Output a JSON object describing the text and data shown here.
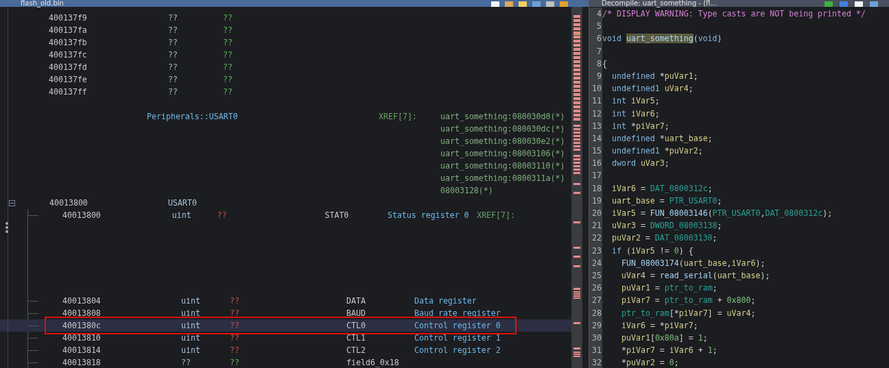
{
  "listing": {
    "title": "flash_old.bin",
    "byte_rows": [
      {
        "address": "400137f9",
        "bytes": "??",
        "value": "??"
      },
      {
        "address": "400137fa",
        "bytes": "??",
        "value": "??"
      },
      {
        "address": "400137fb",
        "bytes": "??",
        "value": "??"
      },
      {
        "address": "400137fc",
        "bytes": "??",
        "value": "??"
      },
      {
        "address": "400137fd",
        "bytes": "??",
        "value": "??"
      },
      {
        "address": "400137fe",
        "bytes": "??",
        "value": "??"
      },
      {
        "address": "400137ff",
        "bytes": "??",
        "value": "??"
      }
    ],
    "label": {
      "name": "Peripherals::USART0",
      "xref_label": "XREF[7]:",
      "xrefs": [
        "uart_something:080030d0(*)",
        "uart_something:080030dc(*)",
        "uart_something:080030e2(*)",
        "uart_something:08003106(*)",
        "uart_something:08003110(*)",
        "uart_something:0800311a(*)",
        "08003128(*)"
      ]
    },
    "struct": {
      "address": "40013800",
      "name": "USART0",
      "expanded": true,
      "fields": [
        {
          "kind": "defined",
          "address": "40013800",
          "type": "uint",
          "value": "??",
          "name": "STAT0",
          "comment": "Status register 0",
          "xref": "XREF[7]:",
          "selected": false,
          "outlined": false
        },
        {
          "kind": "defined",
          "address": "40013804",
          "type": "uint",
          "value": "??",
          "name": "DATA",
          "comment": "Data register",
          "selected": false,
          "outlined": false
        },
        {
          "kind": "defined",
          "address": "40013808",
          "type": "uint",
          "value": "??",
          "name": "BAUD",
          "comment": "Baud rate register",
          "selected": false,
          "outlined": false
        },
        {
          "kind": "defined",
          "address": "4001380c",
          "type": "uint",
          "value": "??",
          "name": "CTL0",
          "comment": "Control register 0",
          "selected": true,
          "outlined": true
        },
        {
          "kind": "defined",
          "address": "40013810",
          "type": "uint",
          "value": "??",
          "name": "CTL1",
          "comment": "Control register 1",
          "selected": false,
          "outlined": false
        },
        {
          "kind": "defined",
          "address": "40013814",
          "type": "uint",
          "value": "??",
          "name": "CTL2",
          "comment": "Control register 2",
          "selected": false,
          "outlined": false
        },
        {
          "kind": "undefined",
          "address": "40013818",
          "type": "??",
          "value": "??",
          "name": "field6_0x18",
          "selected": false,
          "outlined": false
        }
      ]
    }
  },
  "decompiler": {
    "title": "Decompile: uart_something - (fl...",
    "lines": [
      {
        "number": "4",
        "tokens": [
          {
            "text": "/* DISPLAY WARNING: Type casts are NOT being printed */",
            "kind": "comment"
          }
        ]
      },
      {
        "number": "5"
      },
      {
        "number": "6",
        "tokens": [
          {
            "text": "void ",
            "kind": "type"
          },
          {
            "text": "uart_something",
            "kind": "func",
            "highlighted": true
          },
          {
            "text": "(",
            "kind": "plain"
          },
          {
            "text": "void",
            "kind": "type"
          },
          {
            "text": ")",
            "kind": "plain"
          }
        ]
      },
      {
        "number": "7"
      },
      {
        "number": "8",
        "tokens": [
          {
            "text": "{",
            "kind": "plain"
          }
        ],
        "children": [
          {
            "number": "9",
            "tokens": [
              {
                "text": "undefined",
                "kind": "type"
              },
              {
                "text": " *",
                "kind": "plain"
              },
              {
                "text": "puVar1",
                "kind": "var"
              },
              {
                "text": ";",
                "kind": "plain"
              }
            ]
          },
          {
            "number": "10",
            "tokens": [
              {
                "text": "undefined1 ",
                "kind": "type"
              },
              {
                "text": "uVar4",
                "kind": "var"
              },
              {
                "text": ";",
                "kind": "plain"
              }
            ]
          },
          {
            "number": "11",
            "tokens": [
              {
                "text": "int ",
                "kind": "type"
              },
              {
                "text": "iVar5",
                "kind": "var"
              },
              {
                "text": ";",
                "kind": "plain"
              }
            ]
          },
          {
            "number": "12",
            "tokens": [
              {
                "text": "int ",
                "kind": "type"
              },
              {
                "text": "iVar6",
                "kind": "var"
              },
              {
                "text": ";",
                "kind": "plain"
              }
            ]
          },
          {
            "number": "13",
            "tokens": [
              {
                "text": "int",
                "kind": "type"
              },
              {
                "text": " *",
                "kind": "plain"
              },
              {
                "text": "piVar7",
                "kind": "var"
              },
              {
                "text": ";",
                "kind": "plain"
              }
            ]
          },
          {
            "number": "14",
            "tokens": [
              {
                "text": "undefined",
                "kind": "type"
              },
              {
                "text": " *",
                "kind": "plain"
              },
              {
                "text": "uart_base",
                "kind": "var"
              },
              {
                "text": ";",
                "kind": "plain"
              }
            ]
          },
          {
            "number": "15",
            "tokens": [
              {
                "text": "undefined1",
                "kind": "type"
              },
              {
                "text": " *",
                "kind": "plain"
              },
              {
                "text": "puVar2",
                "kind": "var"
              },
              {
                "text": ";",
                "kind": "plain"
              }
            ]
          },
          {
            "number": "16",
            "tokens": [
              {
                "text": "dword ",
                "kind": "type"
              },
              {
                "text": "uVar3",
                "kind": "var"
              },
              {
                "text": ";",
                "kind": "plain"
              }
            ]
          },
          {
            "number": "17"
          },
          {
            "number": "18",
            "tokens": [
              {
                "text": "iVar6",
                "kind": "var"
              },
              {
                "text": " = ",
                "kind": "plain"
              },
              {
                "text": "DAT_0800312c",
                "kind": "global"
              },
              {
                "text": ";",
                "kind": "plain"
              }
            ]
          },
          {
            "number": "19",
            "tokens": [
              {
                "text": "uart_base",
                "kind": "var"
              },
              {
                "text": " = ",
                "kind": "plain"
              },
              {
                "text": "PTR_USART0",
                "kind": "global"
              },
              {
                "text": ";",
                "kind": "plain"
              }
            ]
          },
          {
            "number": "20",
            "tokens": [
              {
                "text": "iVar5",
                "kind": "var"
              },
              {
                "text": " = ",
                "kind": "plain"
              },
              {
                "text": "FUN_08003146",
                "kind": "func"
              },
              {
                "text": "(",
                "kind": "plain"
              },
              {
                "text": "PTR_USART0",
                "kind": "global"
              },
              {
                "text": ",",
                "kind": "plain"
              },
              {
                "text": "DAT_0800312c",
                "kind": "global"
              },
              {
                "text": ");",
                "kind": "plain"
              }
            ]
          },
          {
            "number": "21",
            "tokens": [
              {
                "text": "uVar3",
                "kind": "var"
              },
              {
                "text": " = ",
                "kind": "plain"
              },
              {
                "text": "DWORD_08003138",
                "kind": "global"
              },
              {
                "text": ";",
                "kind": "plain"
              }
            ]
          },
          {
            "number": "22",
            "tokens": [
              {
                "text": "puVar2",
                "kind": "var"
              },
              {
                "text": " = ",
                "kind": "plain"
              },
              {
                "text": "DAT_08003130",
                "kind": "global"
              },
              {
                "text": ";",
                "kind": "plain"
              }
            ]
          },
          {
            "number": "23",
            "tokens": [
              {
                "text": "if",
                "kind": "type"
              },
              {
                "text": " (",
                "kind": "plain"
              },
              {
                "text": "iVar5",
                "kind": "var"
              },
              {
                "text": " != ",
                "kind": "plain"
              },
              {
                "text": "0",
                "kind": "number"
              },
              {
                "text": ") {",
                "kind": "plain"
              }
            ],
            "children": [
              {
                "number": "24",
                "tokens": [
                  {
                    "text": "FUN_08003174",
                    "kind": "func"
                  },
                  {
                    "text": "(",
                    "kind": "plain"
                  },
                  {
                    "text": "uart_base",
                    "kind": "var"
                  },
                  {
                    "text": ",",
                    "kind": "plain"
                  },
                  {
                    "text": "iVar6",
                    "kind": "var"
                  },
                  {
                    "text": ");",
                    "kind": "plain"
                  }
                ]
              },
              {
                "number": "25",
                "tokens": [
                  {
                    "text": "uVar4",
                    "kind": "var"
                  },
                  {
                    "text": " = ",
                    "kind": "plain"
                  },
                  {
                    "text": "read_serial",
                    "kind": "func"
                  },
                  {
                    "text": "(",
                    "kind": "plain"
                  },
                  {
                    "text": "uart_base",
                    "kind": "var"
                  },
                  {
                    "text": ");",
                    "kind": "plain"
                  }
                ]
              },
              {
                "number": "26",
                "tokens": [
                  {
                    "text": "puVar1",
                    "kind": "var"
                  },
                  {
                    "text": " = ",
                    "kind": "plain"
                  },
                  {
                    "text": "ptr_to_ram",
                    "kind": "global"
                  },
                  {
                    "text": ";",
                    "kind": "plain"
                  }
                ]
              },
              {
                "number": "27",
                "tokens": [
                  {
                    "text": "piVar7",
                    "kind": "var"
                  },
                  {
                    "text": " = ",
                    "kind": "plain"
                  },
                  {
                    "text": "ptr_to_ram",
                    "kind": "global"
                  },
                  {
                    "text": " + ",
                    "kind": "plain"
                  },
                  {
                    "text": "0x800",
                    "kind": "number"
                  },
                  {
                    "text": ";",
                    "kind": "plain"
                  }
                ]
              },
              {
                "number": "28",
                "tokens": [
                  {
                    "text": "ptr_to_ram",
                    "kind": "global"
                  },
                  {
                    "text": "[*",
                    "kind": "plain"
                  },
                  {
                    "text": "piVar7",
                    "kind": "var"
                  },
                  {
                    "text": "] = ",
                    "kind": "plain"
                  },
                  {
                    "text": "uVar4",
                    "kind": "var"
                  },
                  {
                    "text": ";",
                    "kind": "plain"
                  }
                ]
              },
              {
                "number": "29",
                "tokens": [
                  {
                    "text": "iVar6",
                    "kind": "var"
                  },
                  {
                    "text": " = *",
                    "kind": "plain"
                  },
                  {
                    "text": "piVar7",
                    "kind": "var"
                  },
                  {
                    "text": ";",
                    "kind": "plain"
                  }
                ]
              },
              {
                "number": "30",
                "tokens": [
                  {
                    "text": "puVar1",
                    "kind": "var"
                  },
                  {
                    "text": "[",
                    "kind": "plain"
                  },
                  {
                    "text": "0x80a",
                    "kind": "number"
                  },
                  {
                    "text": "] = ",
                    "kind": "plain"
                  },
                  {
                    "text": "1",
                    "kind": "number"
                  },
                  {
                    "text": ";",
                    "kind": "plain"
                  }
                ]
              },
              {
                "number": "31",
                "tokens": [
                  {
                    "text": "*",
                    "kind": "plain"
                  },
                  {
                    "text": "piVar7",
                    "kind": "var"
                  },
                  {
                    "text": " = ",
                    "kind": "plain"
                  },
                  {
                    "text": "iVar6",
                    "kind": "var"
                  },
                  {
                    "text": " + ",
                    "kind": "plain"
                  },
                  {
                    "text": "1",
                    "kind": "number"
                  },
                  {
                    "text": ";",
                    "kind": "plain"
                  }
                ]
              },
              {
                "number": "32",
                "tokens": [
                  {
                    "text": "*",
                    "kind": "plain"
                  },
                  {
                    "text": "puVar2",
                    "kind": "var"
                  },
                  {
                    "text": " = ",
                    "kind": "plain"
                  },
                  {
                    "text": "0",
                    "kind": "number"
                  },
                  {
                    "text": ";",
                    "kind": "plain"
                  }
                ]
              }
            ]
          }
        ]
      }
    ]
  }
}
